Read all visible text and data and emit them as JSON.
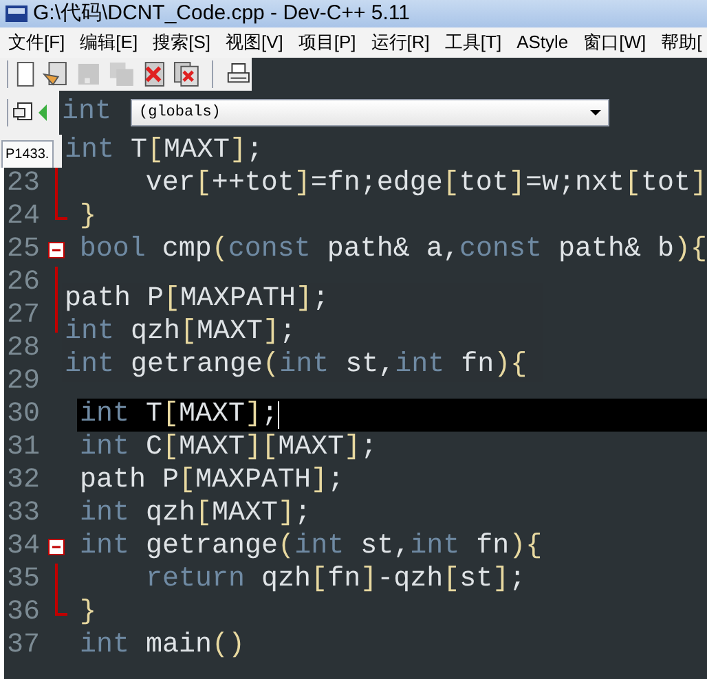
{
  "window": {
    "title": "G:\\代码\\DCNT_Code.cpp - Dev-C++ 5.11"
  },
  "menu": [
    "文件[F]",
    "编辑[E]",
    "搜索[S]",
    "视图[V]",
    "项目[P]",
    "运行[R]",
    "工具[T]",
    "AStyle",
    "窗口[W]",
    "帮助["
  ],
  "toolbar": [
    {
      "kind": "new",
      "disabled": false
    },
    {
      "kind": "open",
      "disabled": false
    },
    {
      "kind": "save",
      "disabled": true
    },
    {
      "kind": "save-all",
      "disabled": true
    },
    {
      "kind": "close",
      "disabled": false
    },
    {
      "kind": "close-all",
      "disabled": false
    },
    {
      "kind": "separator"
    },
    {
      "kind": "print",
      "disabled": false
    }
  ],
  "scope_dropdown": {
    "value": "(globals)"
  },
  "tab": {
    "label": "P1433."
  },
  "ghost_top": [
    {
      "tokens": [
        {
          "text": "int",
          "kind": "keyword"
        }
      ]
    },
    {
      "tokens": [
        {
          "text": "int",
          "kind": "keyword"
        },
        {
          "text": " T",
          "kind": "plain"
        },
        {
          "text": "[",
          "kind": "punct"
        },
        {
          "text": "MAXT",
          "kind": "plain"
        },
        {
          "text": "]",
          "kind": "punct"
        },
        {
          "text": ";",
          "kind": "plain"
        }
      ]
    }
  ],
  "ghost_block": [
    {
      "tokens": [
        {
          "text": "path P",
          "kind": "plain"
        },
        {
          "text": "[",
          "kind": "punct"
        },
        {
          "text": "MAXPATH",
          "kind": "plain"
        },
        {
          "text": "]",
          "kind": "punct"
        },
        {
          "text": ";",
          "kind": "plain"
        }
      ]
    },
    {
      "tokens": [
        {
          "text": "int",
          "kind": "keyword"
        },
        {
          "text": " qzh",
          "kind": "plain"
        },
        {
          "text": "[",
          "kind": "punct"
        },
        {
          "text": "MAXT",
          "kind": "plain"
        },
        {
          "text": "]",
          "kind": "punct"
        },
        {
          "text": ";",
          "kind": "plain"
        }
      ]
    },
    {
      "tokens": [
        {
          "text": "int",
          "kind": "keyword"
        },
        {
          "text": " getrange",
          "kind": "plain"
        },
        {
          "text": "(",
          "kind": "punct"
        },
        {
          "text": "int",
          "kind": "keyword"
        },
        {
          "text": " st,",
          "kind": "plain"
        },
        {
          "text": "int",
          "kind": "keyword"
        },
        {
          "text": " fn",
          "kind": "plain"
        },
        {
          "text": "){",
          "kind": "punct"
        }
      ]
    }
  ],
  "lines": [
    {
      "number": "23",
      "kind": "fold_mid",
      "current": false,
      "tokens": [
        {
          "text": "    ver",
          "kind": "plain"
        },
        {
          "text": "[",
          "kind": "punct"
        },
        {
          "text": "++tot",
          "kind": "plain"
        },
        {
          "text": "]",
          "kind": "punct"
        },
        {
          "text": "=fn;edge",
          "kind": "plain"
        },
        {
          "text": "[",
          "kind": "punct"
        },
        {
          "text": "tot",
          "kind": "plain"
        },
        {
          "text": "]",
          "kind": "punct"
        },
        {
          "text": "=w;nxt",
          "kind": "plain"
        },
        {
          "text": "[",
          "kind": "punct"
        },
        {
          "text": "tot",
          "kind": "plain"
        },
        {
          "text": "]",
          "kind": "punct"
        }
      ]
    },
    {
      "number": "24",
      "kind": "fold_end",
      "current": false,
      "tokens": [
        {
          "text": "}",
          "kind": "punct"
        }
      ]
    },
    {
      "number": "25",
      "kind": "fold_start",
      "current": false,
      "tokens": [
        {
          "text": "bool",
          "kind": "keyword"
        },
        {
          "text": " cmp",
          "kind": "plain"
        },
        {
          "text": "(",
          "kind": "punct"
        },
        {
          "text": "const",
          "kind": "keyword"
        },
        {
          "text": " path& a,",
          "kind": "plain"
        },
        {
          "text": "const",
          "kind": "keyword"
        },
        {
          "text": " path& b",
          "kind": "plain"
        },
        {
          "text": "){",
          "kind": "punct"
        }
      ]
    },
    {
      "number": "26",
      "kind": "fold_mid",
      "current": false
    },
    {
      "number": "27",
      "kind": "fold_mid",
      "current": false
    },
    {
      "number": "28",
      "kind": "plain",
      "current": false
    },
    {
      "number": "29",
      "kind": "plain",
      "current": false
    },
    {
      "number": "30",
      "kind": "plain",
      "current": true,
      "tokens": [
        {
          "text": "int",
          "kind": "keyword"
        },
        {
          "text": " T",
          "kind": "plain"
        },
        {
          "text": "[",
          "kind": "punct"
        },
        {
          "text": "MAXT",
          "kind": "plain"
        },
        {
          "text": "]",
          "kind": "punct"
        },
        {
          "text": ";",
          "kind": "plain"
        }
      ]
    },
    {
      "number": "31",
      "kind": "plain",
      "current": false,
      "tokens": [
        {
          "text": "int",
          "kind": "keyword"
        },
        {
          "text": " C",
          "kind": "plain"
        },
        {
          "text": "[",
          "kind": "punct"
        },
        {
          "text": "MAXT",
          "kind": "plain"
        },
        {
          "text": "][",
          "kind": "punct"
        },
        {
          "text": "MAXT",
          "kind": "plain"
        },
        {
          "text": "]",
          "kind": "punct"
        },
        {
          "text": ";",
          "kind": "plain"
        }
      ]
    },
    {
      "number": "32",
      "kind": "plain",
      "current": false,
      "tokens": [
        {
          "text": "path P",
          "kind": "plain"
        },
        {
          "text": "[",
          "kind": "punct"
        },
        {
          "text": "MAXPATH",
          "kind": "plain"
        },
        {
          "text": "]",
          "kind": "punct"
        },
        {
          "text": ";",
          "kind": "plain"
        }
      ]
    },
    {
      "number": "33",
      "kind": "plain",
      "current": false,
      "tokens": [
        {
          "text": "int",
          "kind": "keyword"
        },
        {
          "text": " qzh",
          "kind": "plain"
        },
        {
          "text": "[",
          "kind": "punct"
        },
        {
          "text": "MAXT",
          "kind": "plain"
        },
        {
          "text": "]",
          "kind": "punct"
        },
        {
          "text": ";",
          "kind": "plain"
        }
      ]
    },
    {
      "number": "34",
      "kind": "fold_start",
      "current": false,
      "tokens": [
        {
          "text": "int",
          "kind": "keyword"
        },
        {
          "text": " getrange",
          "kind": "plain"
        },
        {
          "text": "(",
          "kind": "punct"
        },
        {
          "text": "int",
          "kind": "keyword"
        },
        {
          "text": " st,",
          "kind": "plain"
        },
        {
          "text": "int",
          "kind": "keyword"
        },
        {
          "text": " fn",
          "kind": "plain"
        },
        {
          "text": "){",
          "kind": "punct"
        }
      ]
    },
    {
      "number": "35",
      "kind": "fold_mid",
      "current": false,
      "tokens": [
        {
          "text": "    return",
          "kind": "keyword"
        },
        {
          "text": " qzh",
          "kind": "plain"
        },
        {
          "text": "[",
          "kind": "punct"
        },
        {
          "text": "fn",
          "kind": "plain"
        },
        {
          "text": "]",
          "kind": "punct"
        },
        {
          "text": "-qzh",
          "kind": "plain"
        },
        {
          "text": "[",
          "kind": "punct"
        },
        {
          "text": "st",
          "kind": "plain"
        },
        {
          "text": "]",
          "kind": "punct"
        },
        {
          "text": ";",
          "kind": "plain"
        }
      ]
    },
    {
      "number": "36",
      "kind": "fold_end",
      "current": false,
      "tokens": [
        {
          "text": "}",
          "kind": "punct"
        }
      ]
    },
    {
      "number": "37",
      "kind": "plain",
      "current": false,
      "tokens": [
        {
          "text": "int",
          "kind": "keyword"
        },
        {
          "text": " main",
          "kind": "plain"
        },
        {
          "text": "()",
          "kind": "punct"
        }
      ]
    }
  ]
}
